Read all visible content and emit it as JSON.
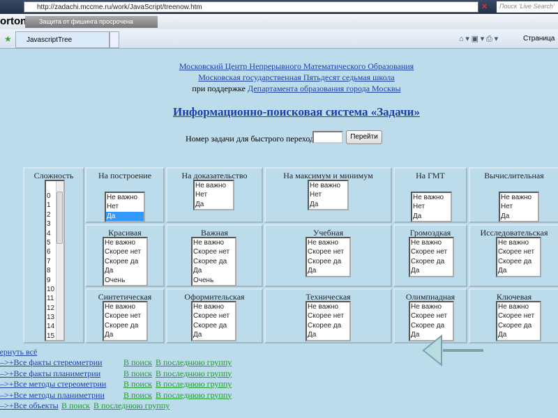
{
  "browser": {
    "url": "http://zadachi.mccme.ru/work/JavaScript/treenow.htm",
    "search_placeholder": "Поиск 'Live Search'",
    "norton": "orton",
    "phishing": "Защита от фишинга просрочена",
    "tab": "JavascriptTree",
    "page_menu": "Страница"
  },
  "header": {
    "line1": "Московский Центр Непрерывного Математического Образования",
    "line2": "Московская государственная Пятьдесят седьмая школа",
    "support_prefix": "при поддержке",
    "support_link": "Департамента образования города Москвы",
    "title": "Информационно-поисковая система «Задачи»"
  },
  "quick": {
    "label": "Номер задачи для быстрого перехода:",
    "value": "",
    "button": "Перейти"
  },
  "complexity": {
    "title": "Сложность",
    "options": [
      "0",
      "1",
      "2",
      "3",
      "4",
      "5",
      "6",
      "7",
      "8",
      "9",
      "10",
      "11",
      "12",
      "13",
      "14",
      "15"
    ]
  },
  "cells": [
    {
      "title": "На построение",
      "options": [
        "Не важно",
        "Нет",
        "Да"
      ],
      "selected": "Да"
    },
    {
      "title": "На доказательство",
      "options": [
        "Не важно",
        "Нет",
        "Да"
      ]
    },
    {
      "title": "На максимум и минимум",
      "options": [
        "Не важно",
        "Нет",
        "Да"
      ]
    },
    {
      "title": "На ГМТ",
      "options": [
        "Не важно",
        "Нет",
        "Да"
      ]
    },
    {
      "title": "Вычислительная",
      "options": [
        "Не важно",
        "Нет",
        "Да"
      ]
    },
    {
      "title": "Красивая",
      "options": [
        "Не важно",
        "Скорее нет",
        "Скорее да",
        "Да",
        "Очень"
      ]
    },
    {
      "title": "Важная",
      "options": [
        "Не важно",
        "Скорее нет",
        "Скорее да",
        "Да",
        "Очень"
      ]
    },
    {
      "title": "Учебная",
      "options": [
        "Не важно",
        "Скорее нет",
        "Скорее да",
        "Да"
      ]
    },
    {
      "title": "Громоздкая",
      "options": [
        "Не важно",
        "Скорее нет",
        "Скорее да",
        "Да"
      ]
    },
    {
      "title": "Исследовательская",
      "options": [
        "Не важно",
        "Скорее нет",
        "Скорее да",
        "Да"
      ]
    },
    {
      "title": "Синтетическая",
      "options": [
        "Не важно",
        "Скорее нет",
        "Скорее да",
        "Да"
      ]
    },
    {
      "title": "Оформительская",
      "options": [
        "Не важно",
        "Скорее нет",
        "Скорее да",
        "Да"
      ]
    },
    {
      "title": "Техническая",
      "options": [
        "Не важно",
        "Скорее нет",
        "Скорее да",
        "Да"
      ]
    },
    {
      "title": "Олимпиадная",
      "options": [
        "Не важно",
        "Скорее нет",
        "Скорее да",
        "Да"
      ]
    },
    {
      "title": "Ключевая",
      "options": [
        "Не важно",
        "Скорее нет",
        "Скорее да",
        "Да"
      ]
    }
  ],
  "collapse": "вернуть всё",
  "tree": [
    {
      "label": "—>+Все факты стереометрии",
      "search": "В поиск",
      "group": "В последнюю группу"
    },
    {
      "label": "—>+Все факты планиметрии",
      "search": "В поиск",
      "group": "В последнюю группу"
    },
    {
      "label": "—>+Все методы стереометрии",
      "search": "В поиск",
      "group": "В последнюю группу"
    },
    {
      "label": "—>+Все методы планиметрии",
      "search": "В поиск",
      "group": "В последнюю группу"
    },
    {
      "label": "—>+Все объекты",
      "search": "В поиск",
      "group": "В последнюю группу"
    }
  ]
}
